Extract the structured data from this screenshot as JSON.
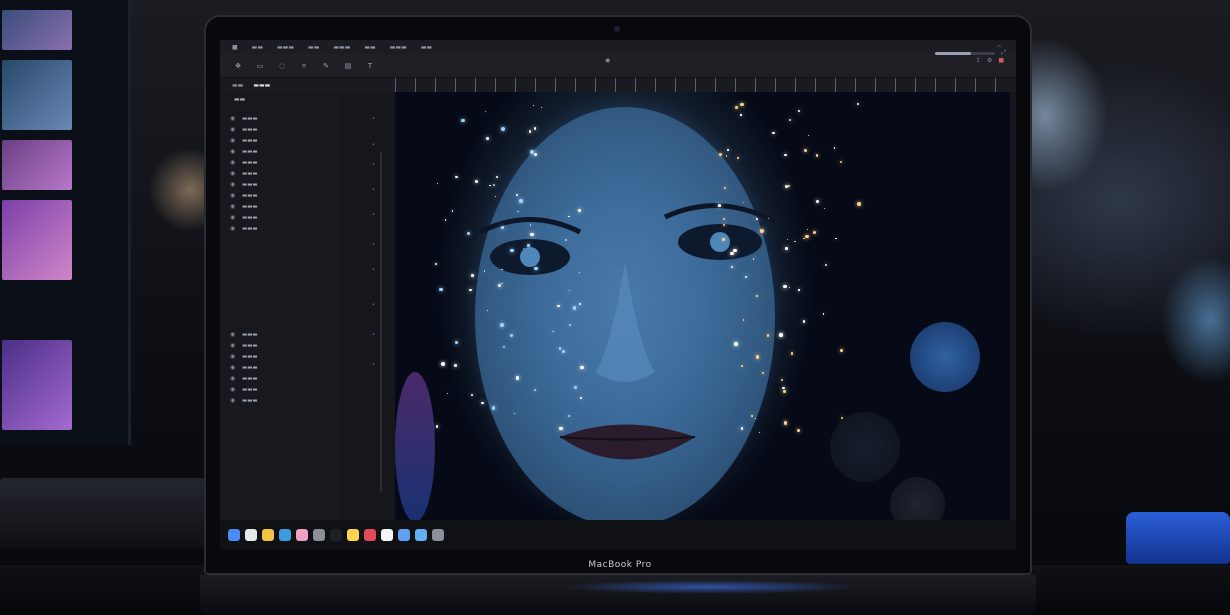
{
  "menu": {
    "items": [
      "",
      "",
      "",
      "",
      "",
      "",
      "",
      ""
    ],
    "right": [
      "",
      ""
    ]
  },
  "toolbar": {
    "tools": [
      "move-tool-icon",
      "select-tool-icon",
      "lasso-tool-icon",
      "crop-tool-icon",
      "brush-tool-icon",
      "eraser-tool-icon",
      "text-tool-icon"
    ],
    "center": [
      "",
      ""
    ],
    "right": [
      "",
      "",
      ""
    ]
  },
  "panel_tabs": [
    "",
    ""
  ],
  "layers": {
    "title": "",
    "group1": [
      "",
      "",
      "",
      "",
      "",
      "",
      "",
      "",
      "",
      "",
      ""
    ],
    "group2": [
      "",
      "",
      "",
      "",
      "",
      "",
      ""
    ]
  },
  "dock": {
    "apps": [
      "finder-icon",
      "safari-icon",
      "chrome-icon",
      "mail-icon",
      "photos-icon",
      "settings-icon",
      "terminal-icon",
      "notes-icon",
      "music-icon",
      "calendar-icon",
      "files-icon",
      "folder-icon",
      "trash-icon"
    ]
  },
  "laptop_model": "MacBook Pro",
  "colors": {
    "accent": "#3b6fe0",
    "screen_bg": "#15171c",
    "canvas_blue": "#2c5a8f"
  }
}
